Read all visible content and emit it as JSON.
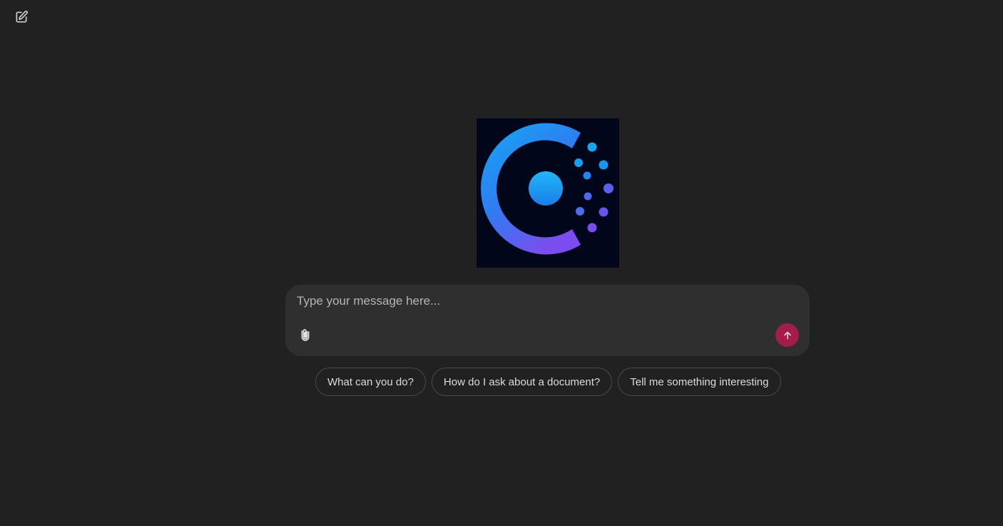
{
  "header": {
    "new_chat_icon": "pencil-square-icon"
  },
  "logo": {
    "icon": "circular-c-logo",
    "colors": {
      "background": "#02061a",
      "cyan": "#14a9f5",
      "blue": "#2f7cf0",
      "violet": "#7b4dee"
    }
  },
  "composer": {
    "placeholder": "Type your message here...",
    "value": "",
    "attach_icon": "paperclip-icon",
    "send_icon": "arrow-up-icon",
    "send_color": "#a21d4b"
  },
  "suggestions": [
    {
      "label": "What can you do?"
    },
    {
      "label": "How do I ask about a document?"
    },
    {
      "label": "Tell me something interesting"
    }
  ]
}
